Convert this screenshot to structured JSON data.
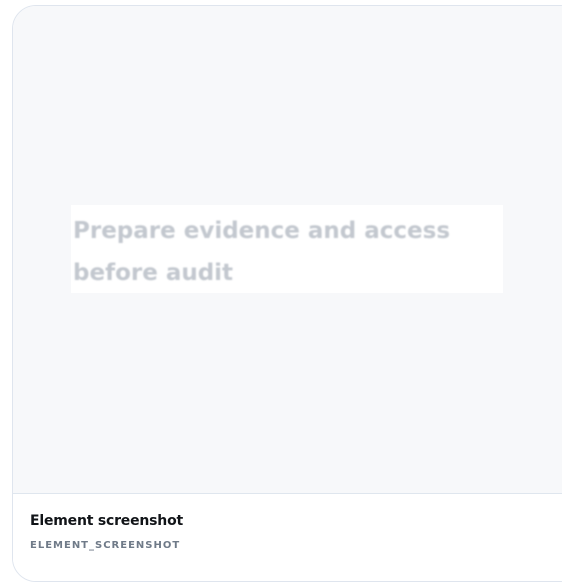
{
  "preview": {
    "snippet_text": "Prepare evidence and access before audit"
  },
  "footer": {
    "title": "Element screenshot",
    "code": "ELEMENT_SCREENSHOT"
  }
}
